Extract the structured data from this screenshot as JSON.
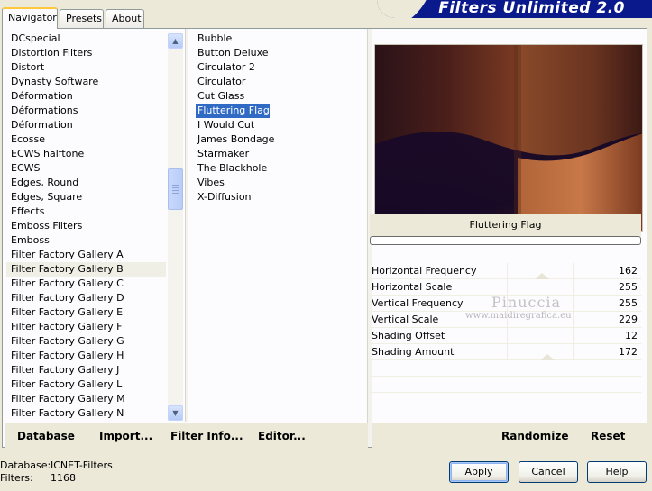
{
  "tabs": [
    "Navigator",
    "Presets",
    "About"
  ],
  "app_title": "Filters Unlimited 2.0",
  "categories": [
    "DCspecial",
    "Distortion Filters",
    "Distort",
    "Dynasty Software",
    "Déformation",
    "Déformations",
    "Déformation",
    "Ecosse",
    "ECWS halftone",
    "ECWS",
    "Edges, Round",
    "Edges, Square",
    "Effects",
    "Emboss Filters",
    "Emboss",
    "Filter Factory Gallery A",
    "Filter Factory Gallery B",
    "Filter Factory Gallery C",
    "Filter Factory Gallery D",
    "Filter Factory Gallery E",
    "Filter Factory Gallery F",
    "Filter Factory Gallery G",
    "Filter Factory Gallery H",
    "Filter Factory Gallery J",
    "Filter Factory Gallery L",
    "Filter Factory Gallery M",
    "Filter Factory Gallery N"
  ],
  "selected_category": "Filter Factory Gallery B",
  "filters": [
    "Bubble",
    "Button Deluxe",
    "Circulator 2",
    "Circulator",
    "Cut Glass",
    "Fluttering Flag",
    "I Would Cut",
    "James Bondage",
    "Starmaker",
    "The Blackhole",
    "Vibes",
    "X-Diffusion"
  ],
  "selected_filter": "Fluttering Flag",
  "current_filter_name": "Fluttering Flag",
  "parameters": [
    {
      "label": "Horizontal Frequency",
      "value": "162"
    },
    {
      "label": "Horizontal Scale",
      "value": "255"
    },
    {
      "label": "Vertical Frequency",
      "value": "255"
    },
    {
      "label": "Vertical Scale",
      "value": "229"
    },
    {
      "label": "Shading Offset",
      "value": "12"
    },
    {
      "label": "Shading Amount",
      "value": "172"
    }
  ],
  "watermark": {
    "name": "Pinuccia",
    "url": "www.maidiregrafica.eu"
  },
  "toolbar": {
    "database": "Database",
    "import": "Import...",
    "filter_info": "Filter Info...",
    "editor": "Editor...",
    "randomize": "Randomize",
    "reset": "Reset"
  },
  "status": {
    "database_label": "Database:",
    "database_value": "ICNET-Filters",
    "filters_label": "Filters:",
    "filters_value": "1168"
  },
  "buttons": {
    "apply": "Apply",
    "cancel": "Cancel",
    "help": "Help"
  },
  "colors": {
    "selection": "#316ac5",
    "banner": "#0a1a8c"
  }
}
